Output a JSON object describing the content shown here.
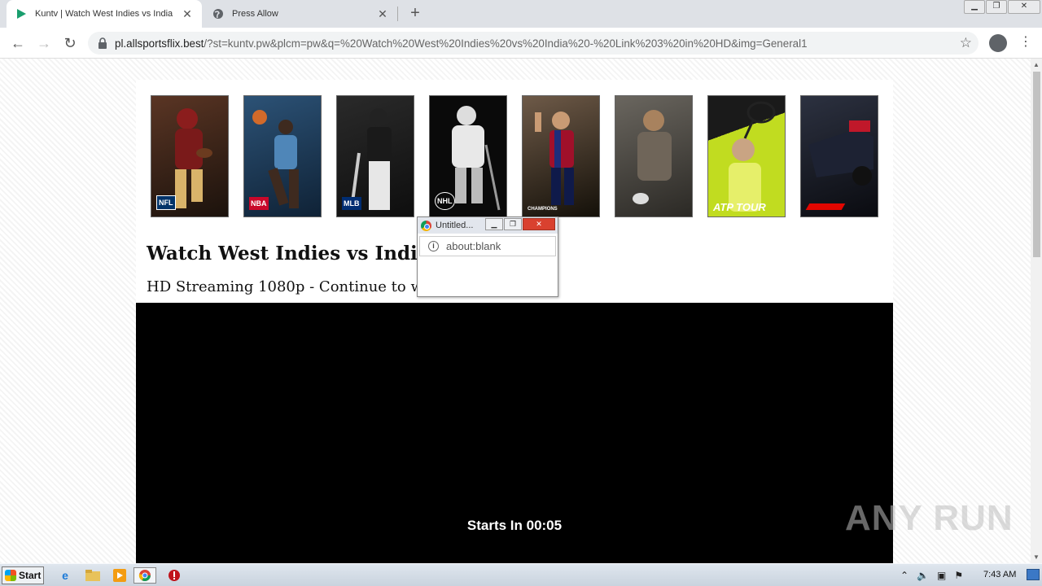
{
  "browser": {
    "tabs": [
      {
        "title": "Kuntv | Watch West Indies vs India",
        "active": true
      },
      {
        "title": "Press Allow",
        "active": false
      }
    ],
    "url_host": "pl.allsportsflix.best",
    "url_path": "/?st=kuntv.pw&plcm=pw&q=%20Watch%20West%20Indies%20vs%20India%20-%20Link%203%20in%20HD&img=General1"
  },
  "page": {
    "sports": [
      {
        "name": "NFL",
        "icon": "football-player-icon",
        "logo": "NFL",
        "bg": "#3a2418"
      },
      {
        "name": "NBA",
        "icon": "basketball-player-icon",
        "logo": "NBA",
        "bg": "#1e3a56"
      },
      {
        "name": "MLB",
        "icon": "baseball-player-icon",
        "logo": "MLB",
        "bg": "#1c1c1c"
      },
      {
        "name": "NHL",
        "icon": "hockey-player-icon",
        "logo": "NHL",
        "bg": "#0d0d0d"
      },
      {
        "name": "Champions League",
        "icon": "soccer-player-icon",
        "logo": "CHAMPIONS",
        "bg": "#221a14"
      },
      {
        "name": "Rugby",
        "icon": "rugby-player-icon",
        "logo": "",
        "bg": "#45423d"
      },
      {
        "name": "ATP Tour",
        "icon": "tennis-player-icon",
        "logo": "ATP TOUR",
        "bg": "#b5d320"
      },
      {
        "name": "F1",
        "icon": "f1-car-icon",
        "logo": "F1",
        "bg": "#151820"
      }
    ],
    "title": "Watch West Indies vs India -",
    "subtitle": "HD Streaming 1080p - Continue to watc",
    "countdown": "Starts In 00:05",
    "watermark": "ANY RUN"
  },
  "popup": {
    "title": "Untitled...",
    "address": "about:blank"
  },
  "taskbar": {
    "start_label": "Start",
    "clock": "7:43 AM"
  }
}
